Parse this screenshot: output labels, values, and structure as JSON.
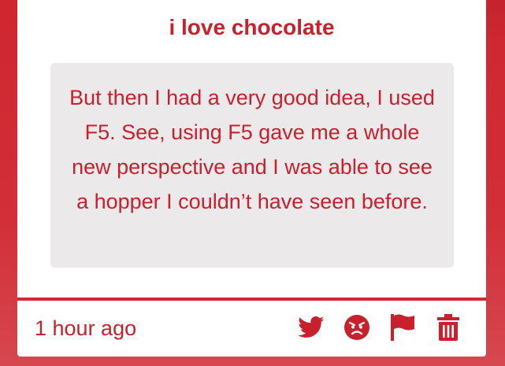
{
  "post": {
    "title": "i love chocolate",
    "message": "But then I had a very good idea, I used F5. See, using F5 gave me a whole new perspective and I was able to see a hopper I couldn’t have seen before.",
    "timestamp": "1 hour ago"
  },
  "actions": [
    {
      "name": "share-twitter-button",
      "icon": "twitter-icon"
    },
    {
      "name": "angry-reaction-button",
      "icon": "angry-face-icon"
    },
    {
      "name": "report-flag-button",
      "icon": "flag-icon"
    },
    {
      "name": "delete-button",
      "icon": "trash-icon"
    }
  ],
  "colors": {
    "accent": "#c8202d",
    "background": "#cf2630",
    "card": "#ffffff",
    "message_box": "#ebe9ea"
  }
}
